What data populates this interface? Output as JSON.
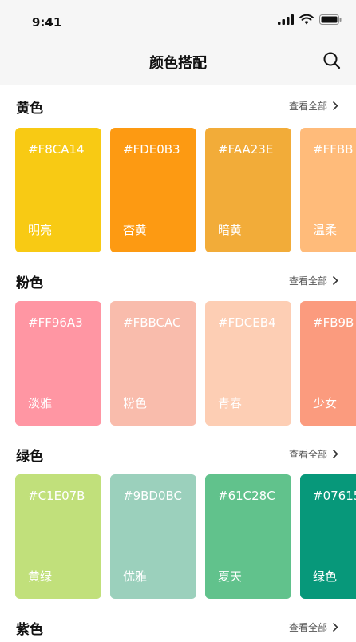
{
  "status_bar": {
    "time": "9:41"
  },
  "nav": {
    "title": "颜色搭配"
  },
  "view_all_label": "查看全部",
  "sections": [
    {
      "title": "黄色",
      "cards": [
        {
          "hex": "#F8CA14",
          "name": "明亮",
          "color": "#F8CA14"
        },
        {
          "hex": "#FDE0B3",
          "name": "杏黄",
          "color": "#FD9A12"
        },
        {
          "hex": "#FAA23E",
          "name": "暗黄",
          "color": "#F2AC39"
        },
        {
          "hex": "#FFBB",
          "name": "温柔",
          "color": "#FFBB7A"
        }
      ]
    },
    {
      "title": "粉色",
      "cards": [
        {
          "hex": "#FF96A3",
          "name": "淡雅",
          "color": "#FF96A3"
        },
        {
          "hex": "#FBBCAC",
          "name": "粉色",
          "color": "#F9BCAC"
        },
        {
          "hex": "#FDCEB4",
          "name": "青春",
          "color": "#FDCEB4"
        },
        {
          "hex": "#FB9B",
          "name": "少女",
          "color": "#FB9B7E"
        }
      ]
    },
    {
      "title": "绿色",
      "cards": [
        {
          "hex": "#C1E07B",
          "name": "黄绿",
          "color": "#C1E07B"
        },
        {
          "hex": "#9BD0BC",
          "name": "优雅",
          "color": "#9BD0BC"
        },
        {
          "hex": "#61C28C",
          "name": "夏天",
          "color": "#61C28C"
        },
        {
          "hex": "#07615",
          "name": "绿色",
          "color": "#07987A"
        }
      ]
    },
    {
      "title": "紫色",
      "cards": []
    }
  ]
}
